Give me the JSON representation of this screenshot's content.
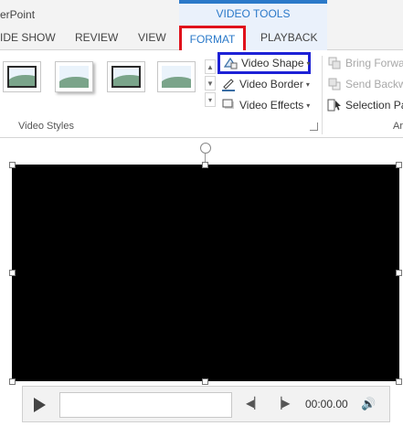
{
  "app": {
    "title_fragment": "erPoint"
  },
  "contextual": {
    "group_title": "VIDEO TOOLS"
  },
  "tabs": [
    {
      "label": "IDE SHOW"
    },
    {
      "label": "REVIEW"
    },
    {
      "label": "VIEW"
    },
    {
      "label": "FORMAT"
    },
    {
      "label": "PLAYBACK"
    }
  ],
  "ribbon": {
    "video_styles_label": "Video Styles",
    "arrange_label_fragment": "Ar",
    "video_shape": "Video Shape",
    "video_border": "Video Border",
    "video_effects": "Video Effects",
    "bring_forward": "Bring Forwa",
    "send_backward": "Send Backw",
    "selection_pane": "Selection Pa"
  },
  "player": {
    "time": "00:00.00"
  },
  "colors": {
    "accent": "#2b79c9",
    "format_highlight": "#e0111b",
    "shape_highlight": "#1d21d6"
  }
}
